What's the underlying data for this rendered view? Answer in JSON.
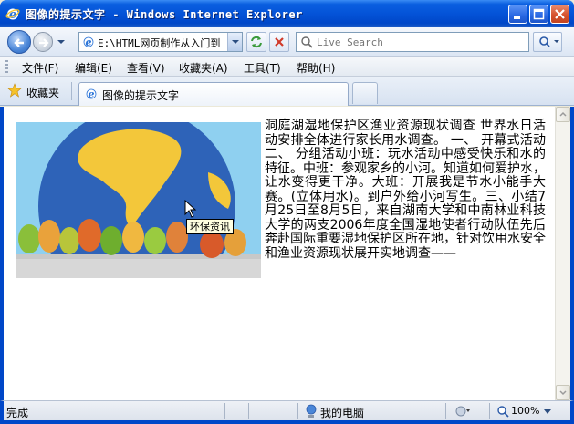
{
  "window": {
    "title": "图像的提示文字 - Windows Internet Explorer"
  },
  "address_bar": {
    "url": "E:\\HTML网页制作从入门到",
    "search_placeholder": "Live Search"
  },
  "menu": {
    "items": [
      "文件(F)",
      "编辑(E)",
      "查看(V)",
      "收藏夹(A)",
      "工具(T)",
      "帮助(H)"
    ]
  },
  "favorites": {
    "label": "收藏夹"
  },
  "tabs": [
    {
      "label": "图像的提示文字",
      "active": true
    }
  ],
  "page": {
    "image": {
      "title_tooltip": "环保资讯",
      "icon": "earth-and-trees-illustration"
    },
    "body_text": "洞庭湖湿地保护区渔业资源现状调查 世界水日活动安排全体进行家长用水调查。 一、 开幕式活动二、 分组活动小班：玩水活动中感受快乐和水的特征。中班：参观家乡的小河。知道如何爱护水，让水变得更干净。大班：开展我是节水小能手大赛。(立体用水)。到户外给小河写生。三、小结7月25日至8月5日，来自湖南大学和中南林业科技大学的两支2006年度全国湿地使者行动队伍先后奔赴国际重要湿地保护区所在地，针对饮用水安全和渔业资源现状展开实地调查——"
  },
  "status_bar": {
    "status": "完成",
    "zone": "我的电脑",
    "zoom": "100%"
  },
  "colors": {
    "titlebar": "#0453D8",
    "frame": "#0047C8",
    "tooltip_bg": "#FFFFE1"
  }
}
